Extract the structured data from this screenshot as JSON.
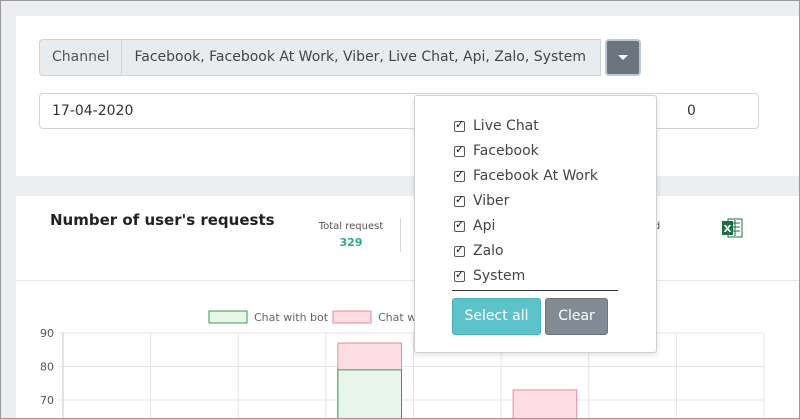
{
  "filter": {
    "channel_label": "Channel",
    "channel_value": "Facebook, Facebook At Work, Viber, Live Chat, Api, Zalo, System",
    "date_value": "17-04-2020",
    "date_tail": "0"
  },
  "dropdown": {
    "options": [
      {
        "label": "Live Chat",
        "checked": true
      },
      {
        "label": "Facebook",
        "checked": true
      },
      {
        "label": "Facebook At Work",
        "checked": true
      },
      {
        "label": "Viber",
        "checked": true
      },
      {
        "label": "Api",
        "checked": true
      },
      {
        "label": "Zalo",
        "checked": true
      },
      {
        "label": "System",
        "checked": true
      }
    ],
    "select_all_label": "Select all",
    "clear_label": "Clear"
  },
  "stats": {
    "title": "Number of user's requests",
    "total_request_label": "Total request",
    "total_request_value": "329",
    "called_label_partial": "alled"
  },
  "colors": {
    "teal_accent": "#2eaa8a",
    "bot_fill": "#e8f5ea",
    "bot_stroke": "#3a9a4a",
    "pink_fill": "#fddde3",
    "pink_stroke": "#e88a9c",
    "excel_green": "#1e7145"
  },
  "chart_data": {
    "type": "bar",
    "stacked": true,
    "y_ticks": [
      "90",
      "80",
      "70"
    ],
    "ylim_visible": [
      65,
      90
    ],
    "legend": [
      {
        "label": "Chat with bot",
        "color": "#e8f5ea"
      },
      {
        "label": "Chat w",
        "color": "#fddde3"
      }
    ],
    "visible_bars": [
      {
        "slot": 3,
        "bot": 79,
        "total": 87
      },
      {
        "slot": 5,
        "bot": null,
        "total": 73
      }
    ]
  }
}
